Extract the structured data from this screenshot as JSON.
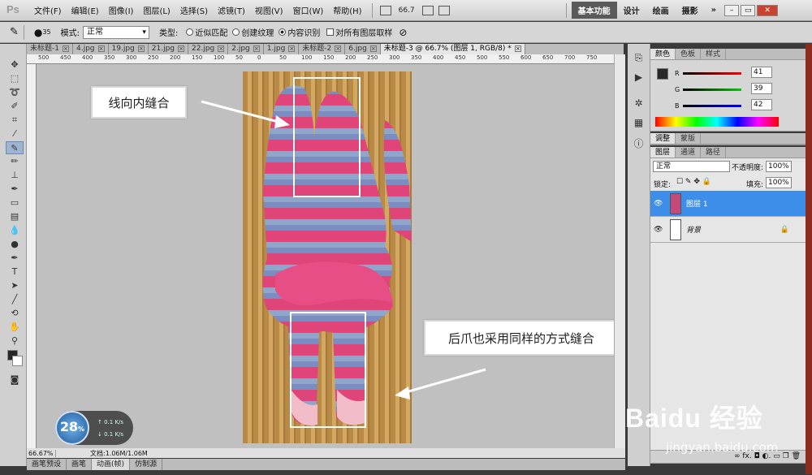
{
  "app": {
    "logo": "Ps"
  },
  "menu": [
    "文件(F)",
    "编辑(E)",
    "图像(I)",
    "图层(L)",
    "选择(S)",
    "滤镜(T)",
    "视图(V)",
    "窗口(W)",
    "帮助(H)"
  ],
  "menubar": {
    "zoom": "66.7",
    "workspaces": [
      "基本功能",
      "设计",
      "绘画",
      "摄影"
    ],
    "more": "»"
  },
  "options": {
    "brush_size": "35",
    "mode_label": "模式:",
    "mode_value": "正常",
    "type_label": "类型:",
    "radio1": "近似匹配",
    "radio2": "创建纹理",
    "radio3": "内容识别",
    "checkbox": "对所有图层取样"
  },
  "tabs": [
    {
      "label": "未标题-1"
    },
    {
      "label": "4.jpg"
    },
    {
      "label": "19.jpg"
    },
    {
      "label": "21.jpg"
    },
    {
      "label": "22.jpg"
    },
    {
      "label": "2.jpg"
    },
    {
      "label": "1.jpg"
    },
    {
      "label": "未标题-2"
    },
    {
      "label": "6.jpg"
    },
    {
      "label": "未标题-3 @ 66.7% (图层 1, RGB/8) *"
    }
  ],
  "ruler_h": [
    "500",
    "450",
    "400",
    "350",
    "300",
    "250",
    "200",
    "150",
    "100",
    "50",
    "0",
    "50",
    "100",
    "150",
    "200",
    "250",
    "300",
    "350",
    "400",
    "450",
    "500",
    "550",
    "600",
    "650",
    "700",
    "750"
  ],
  "canvas": {
    "callout1": "线向内缝合",
    "callout2": "后爪也采用同样的方式缝合"
  },
  "status": {
    "zoom": "66.67%",
    "doc": "文档:1.06M/1.06M"
  },
  "bottom_tabs": [
    "画笔预设",
    "画笔",
    "动画(帧)",
    "仿制源"
  ],
  "speed": {
    "value": "28",
    "unit": "%",
    "up": "0.1",
    "up_unit": "K/s",
    "down": "0.1",
    "down_unit": "K/s"
  },
  "color_panel": {
    "tabs": [
      "颜色",
      "色板",
      "样式"
    ],
    "r": "41",
    "g": "39",
    "b": "42",
    "r_label": "R",
    "g_label": "G",
    "b_label": "B"
  },
  "adjust_panel": {
    "tabs": [
      "调整",
      "蒙版"
    ]
  },
  "layers_panel": {
    "tabs": [
      "图层",
      "通道",
      "路径"
    ],
    "blend": "正常",
    "opacity_label": "不透明度:",
    "opacity": "100%",
    "lock_label": "锁定:",
    "fill_label": "填充:",
    "fill": "100%",
    "layers": [
      {
        "name": "图层 1",
        "selected": true
      },
      {
        "name": "背景",
        "selected": false
      }
    ]
  },
  "watermark": {
    "main": "Baidu 经验",
    "sub": "jingyan.baidu.com"
  }
}
